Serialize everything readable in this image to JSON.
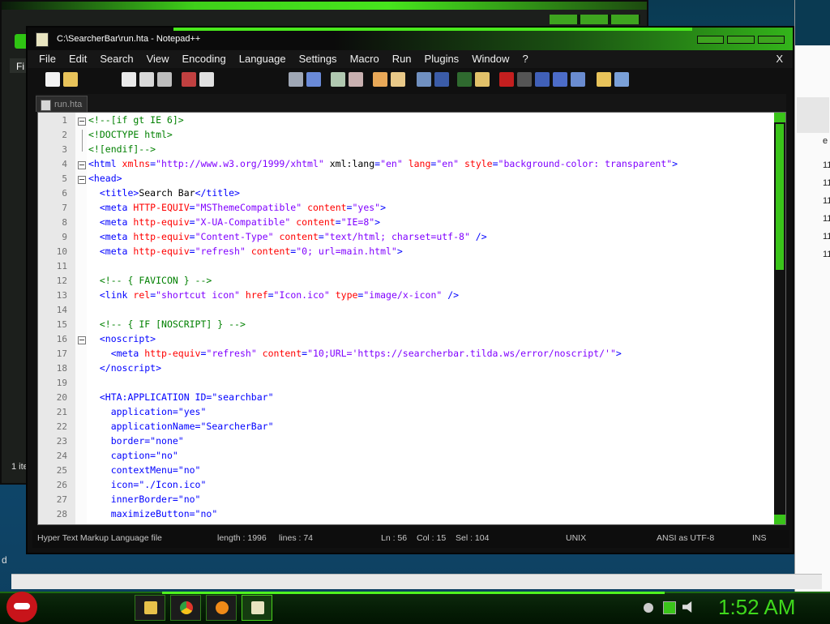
{
  "background": {
    "left_menu_stub": "Fi",
    "left_status_stub": "1 ite",
    "left_bottom_stub": "d",
    "right_stub_char": "e",
    "right_numbers": [
      "11",
      "11",
      "11",
      "11",
      "11",
      "11"
    ]
  },
  "window": {
    "title": "C:\\SearcherBar\\run.hta - Notepad++"
  },
  "menu": {
    "items": [
      "File",
      "Edit",
      "Search",
      "View",
      "Encoding",
      "Language",
      "Settings",
      "Macro",
      "Run",
      "Plugins",
      "Window",
      "?"
    ],
    "close_label": "X"
  },
  "tabs": [
    {
      "label": "run.hta"
    }
  ],
  "editor": {
    "lines": [
      {
        "n": "1",
        "fold": "box"
      },
      {
        "n": "2",
        "fold": "line"
      },
      {
        "n": "3",
        "fold": "end"
      },
      {
        "n": "4",
        "fold": "box"
      },
      {
        "n": "5",
        "fold": "box"
      },
      {
        "n": "6"
      },
      {
        "n": "7"
      },
      {
        "n": "8"
      },
      {
        "n": "9"
      },
      {
        "n": "10"
      },
      {
        "n": "11"
      },
      {
        "n": "12"
      },
      {
        "n": "13"
      },
      {
        "n": "14"
      },
      {
        "n": "15"
      },
      {
        "n": "16",
        "fold": "box"
      },
      {
        "n": "17"
      },
      {
        "n": "18"
      },
      {
        "n": "19"
      },
      {
        "n": "20"
      },
      {
        "n": "21"
      },
      {
        "n": "22"
      },
      {
        "n": "23"
      },
      {
        "n": "24"
      },
      {
        "n": "25"
      },
      {
        "n": "26"
      },
      {
        "n": "27"
      },
      {
        "n": "28"
      }
    ],
    "code": [
      [
        [
          "c",
          "<!--[if gt IE 6]>"
        ]
      ],
      [
        [
          "c",
          "<!DOCTYPE html>"
        ]
      ],
      [
        [
          "c",
          "<![endif]-->"
        ]
      ],
      [
        [
          "g",
          "<html "
        ],
        [
          "a",
          "xmlns"
        ],
        [
          "g",
          "="
        ],
        [
          "s",
          "\"http://www.w3.org/1999/xhtml\""
        ],
        [
          "t",
          " xml:lang"
        ],
        [
          "g",
          "="
        ],
        [
          "s",
          "\"en\""
        ],
        [
          "a",
          " lang"
        ],
        [
          "g",
          "="
        ],
        [
          "s",
          "\"en\""
        ],
        [
          "a",
          " style"
        ],
        [
          "g",
          "="
        ],
        [
          "s",
          "\"background-color: transparent\""
        ],
        [
          "g",
          ">"
        ]
      ],
      [
        [
          "g",
          "<head>"
        ]
      ],
      [
        [
          "t",
          "  "
        ],
        [
          "g",
          "<title>"
        ],
        [
          "t",
          "Search Bar"
        ],
        [
          "g",
          "</title>"
        ]
      ],
      [
        [
          "t",
          "  "
        ],
        [
          "g",
          "<meta "
        ],
        [
          "a",
          "HTTP-EQUIV"
        ],
        [
          "g",
          "="
        ],
        [
          "s",
          "\"MSThemeCompatible\""
        ],
        [
          "a",
          " content"
        ],
        [
          "g",
          "="
        ],
        [
          "s",
          "\"yes\""
        ],
        [
          "g",
          ">"
        ]
      ],
      [
        [
          "t",
          "  "
        ],
        [
          "g",
          "<meta "
        ],
        [
          "a",
          "http-equiv"
        ],
        [
          "g",
          "="
        ],
        [
          "s",
          "\"X-UA-Compatible\""
        ],
        [
          "a",
          " content"
        ],
        [
          "g",
          "="
        ],
        [
          "s",
          "\"IE=8\""
        ],
        [
          "g",
          ">"
        ]
      ],
      [
        [
          "t",
          "  "
        ],
        [
          "g",
          "<meta "
        ],
        [
          "a",
          "http-equiv"
        ],
        [
          "g",
          "="
        ],
        [
          "s",
          "\"Content-Type\""
        ],
        [
          "a",
          " content"
        ],
        [
          "g",
          "="
        ],
        [
          "s",
          "\"text/html; charset=utf-8\""
        ],
        [
          "g",
          " />"
        ]
      ],
      [
        [
          "t",
          "  "
        ],
        [
          "g",
          "<meta "
        ],
        [
          "a",
          "http-equiv"
        ],
        [
          "g",
          "="
        ],
        [
          "s",
          "\"refresh\""
        ],
        [
          "a",
          " content"
        ],
        [
          "g",
          "="
        ],
        [
          "s",
          "\"0; url=main.html\""
        ],
        [
          "g",
          ">"
        ]
      ],
      [],
      [
        [
          "t",
          "  "
        ],
        [
          "c",
          "<!-- { FAVICON } -->"
        ]
      ],
      [
        [
          "t",
          "  "
        ],
        [
          "g",
          "<link "
        ],
        [
          "a",
          "rel"
        ],
        [
          "g",
          "="
        ],
        [
          "s",
          "\"shortcut icon\""
        ],
        [
          "a",
          " href"
        ],
        [
          "g",
          "="
        ],
        [
          "s",
          "\"Icon.ico\""
        ],
        [
          "a",
          " type"
        ],
        [
          "g",
          "="
        ],
        [
          "s",
          "\"image/x-icon\""
        ],
        [
          "g",
          " />"
        ]
      ],
      [],
      [
        [
          "t",
          "  "
        ],
        [
          "c",
          "<!-- { IF [NOSCRIPT] } -->"
        ]
      ],
      [
        [
          "t",
          "  "
        ],
        [
          "g",
          "<noscript>"
        ]
      ],
      [
        [
          "t",
          "    "
        ],
        [
          "g",
          "<meta "
        ],
        [
          "a",
          "http-equiv"
        ],
        [
          "g",
          "="
        ],
        [
          "s",
          "\"refresh\""
        ],
        [
          "a",
          " content"
        ],
        [
          "g",
          "="
        ],
        [
          "s",
          "\"10;URL='https://searcherbar.tilda.ws/error/noscript/'\""
        ],
        [
          "g",
          ">"
        ]
      ],
      [
        [
          "t",
          "  "
        ],
        [
          "g",
          "</noscript>"
        ]
      ],
      [],
      [
        [
          "t",
          "  "
        ],
        [
          "g",
          "<HTA:APPLICATION ID=\"searchbar\""
        ]
      ],
      [
        [
          "t",
          "    "
        ],
        [
          "g",
          "application=\"yes\""
        ]
      ],
      [
        [
          "t",
          "    "
        ],
        [
          "g",
          "applicationName=\"SearcherBar\""
        ]
      ],
      [
        [
          "t",
          "    "
        ],
        [
          "g",
          "border=\"none\""
        ]
      ],
      [
        [
          "t",
          "    "
        ],
        [
          "g",
          "caption=\"no\""
        ]
      ],
      [
        [
          "t",
          "    "
        ],
        [
          "g",
          "contextMenu=\"no\""
        ]
      ],
      [
        [
          "t",
          "    "
        ],
        [
          "g",
          "icon=\"./Icon.ico\""
        ]
      ],
      [
        [
          "t",
          "    "
        ],
        [
          "g",
          "innerBorder=\"no\""
        ]
      ],
      [
        [
          "t",
          "    "
        ],
        [
          "g",
          "maximizeButton=\"no\""
        ]
      ]
    ]
  },
  "status": {
    "file_type": "Hyper Text Markup Language file",
    "length": "length : 1996",
    "lines": "lines : 74",
    "ln": "Ln : 56",
    "col": "Col : 15",
    "sel": "Sel : 104",
    "eol": "UNIX",
    "encoding": "ANSI as UTF-8",
    "mode": "INS"
  },
  "taskbar": {
    "clock": "1:52 AM",
    "apps": [
      "folder-icon",
      "chrome-icon",
      "search-tool-icon",
      "notepad-icon"
    ]
  },
  "colors": {
    "accent_green": "#3ac41a",
    "clock_green": "#3fd81c",
    "tag_blue": "#0000ff",
    "attr_red": "#ff0000",
    "string_purple": "#8000ff",
    "comment_green": "#008000"
  }
}
